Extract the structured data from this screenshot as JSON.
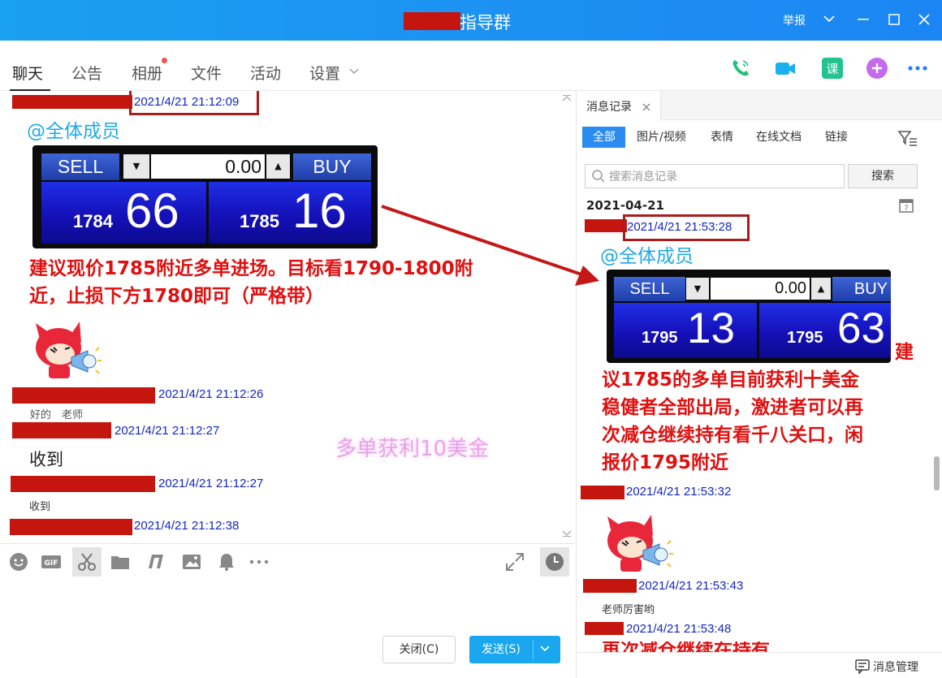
{
  "window": {
    "title": "指导群",
    "report": "举报"
  },
  "tabs": [
    "聊天",
    "公告",
    "相册",
    "文件",
    "活动",
    "设置"
  ],
  "chat": {
    "messages": {
      "m1_ts": "2021/4/21 21:12:09",
      "m1_mention": "@全体成员",
      "m1_text_l1": "建议现价1785附近多单进场。目标看1790-1800附",
      "m1_text_l2": "近，止损下方1780即可（严格带）",
      "m2_ts": "2021/4/21 21:12:26",
      "m2_text": "好的　老师",
      "m3_ts": "2021/4/21 21:12:27",
      "m3_text": "收到",
      "m4_ts": "2021/4/21 21:12:27",
      "m4_text": "收到",
      "m5_ts": "2021/4/21 21:12:38"
    },
    "trade_widget_1": {
      "sell": "SELL",
      "buy": "BUY",
      "qty": "0.00",
      "sell_small": "1784",
      "sell_big": "66",
      "buy_small": "1785",
      "buy_big": "16"
    },
    "watermark": "多单获利10美金"
  },
  "composer": {
    "close_label": "关闭(C)",
    "send_label": "发送(S)"
  },
  "history": {
    "tab_label": "消息记录",
    "filters": [
      "全部",
      "图片/视频",
      "表情",
      "在线文档",
      "链接"
    ],
    "search_placeholder": "搜索消息记录",
    "search_button": "搜索",
    "date_header": "2021-04-21",
    "r1_ts": "2021/4/21 21:53:28",
    "r1_mention": "@全体成员",
    "r1_text_l1": "建",
    "r1_text_l2": "议1785的多单目前获利十美金",
    "r1_text_l3": "稳健者全部出局，激进者可以再",
    "r1_text_l4": "次减仓继续持有看千八关口，闲",
    "r1_text_l5": "报价1795附近",
    "r2_ts": "2021/4/21 21:53:32",
    "r3_ts": "2021/4/21 21:53:43",
    "r3_text": "老师厉害哟",
    "r4_ts": "2021/4/21 21:53:48",
    "r4_text": "再次减仓继续在持有",
    "manage_label": "消息管理",
    "calendar_day": "7"
  },
  "trade_widget_2": {
    "sell": "SELL",
    "buy": "BUY",
    "qty": "0.00",
    "sell_small": "1795",
    "sell_big": "13",
    "buy_small": "1795",
    "buy_big": "63"
  },
  "colors": {
    "title_bar": "#1b93f1",
    "timestamp": "#1326c4",
    "annotation_red": "#e01010",
    "send_button": "#1aa7f0"
  }
}
